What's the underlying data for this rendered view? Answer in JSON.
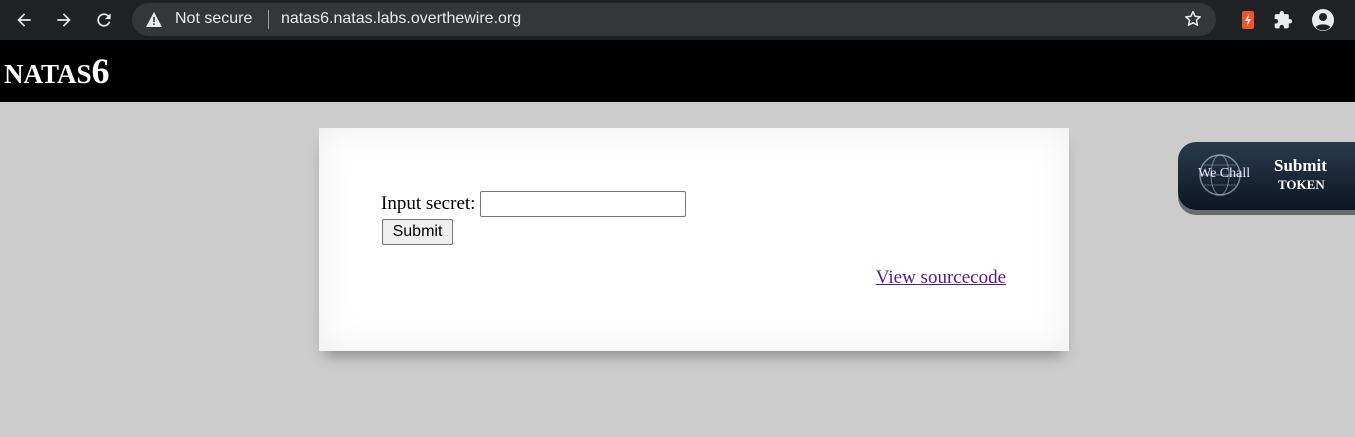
{
  "browser": {
    "security_label": "Not secure",
    "url": "natas6.natas.labs.overthewire.org",
    "icons": [
      "back-arrow-icon",
      "forward-arrow-icon",
      "reload-icon",
      "warning-icon",
      "bookmark-star-icon",
      "extension-icon",
      "extensions-puzzle-icon",
      "profile-icon"
    ],
    "colors": {
      "toolbar": "#202124",
      "omnibox": "#35363a",
      "text": "#e8eaed"
    }
  },
  "header": {
    "title_part1": "NATAS",
    "title_part2": "6"
  },
  "form": {
    "secret_label": "Input secret:",
    "secret_value": "",
    "submit_label": "Submit",
    "source_link": "View sourcecode"
  },
  "badge": {
    "logo_text": "We Chall",
    "line1": "Submit",
    "line2": "TOKEN"
  },
  "colors": {
    "page_bg": "#cccccc",
    "header_bg": "#000000",
    "content_bg": "#ffffff",
    "link_visited": "#551a8b"
  }
}
